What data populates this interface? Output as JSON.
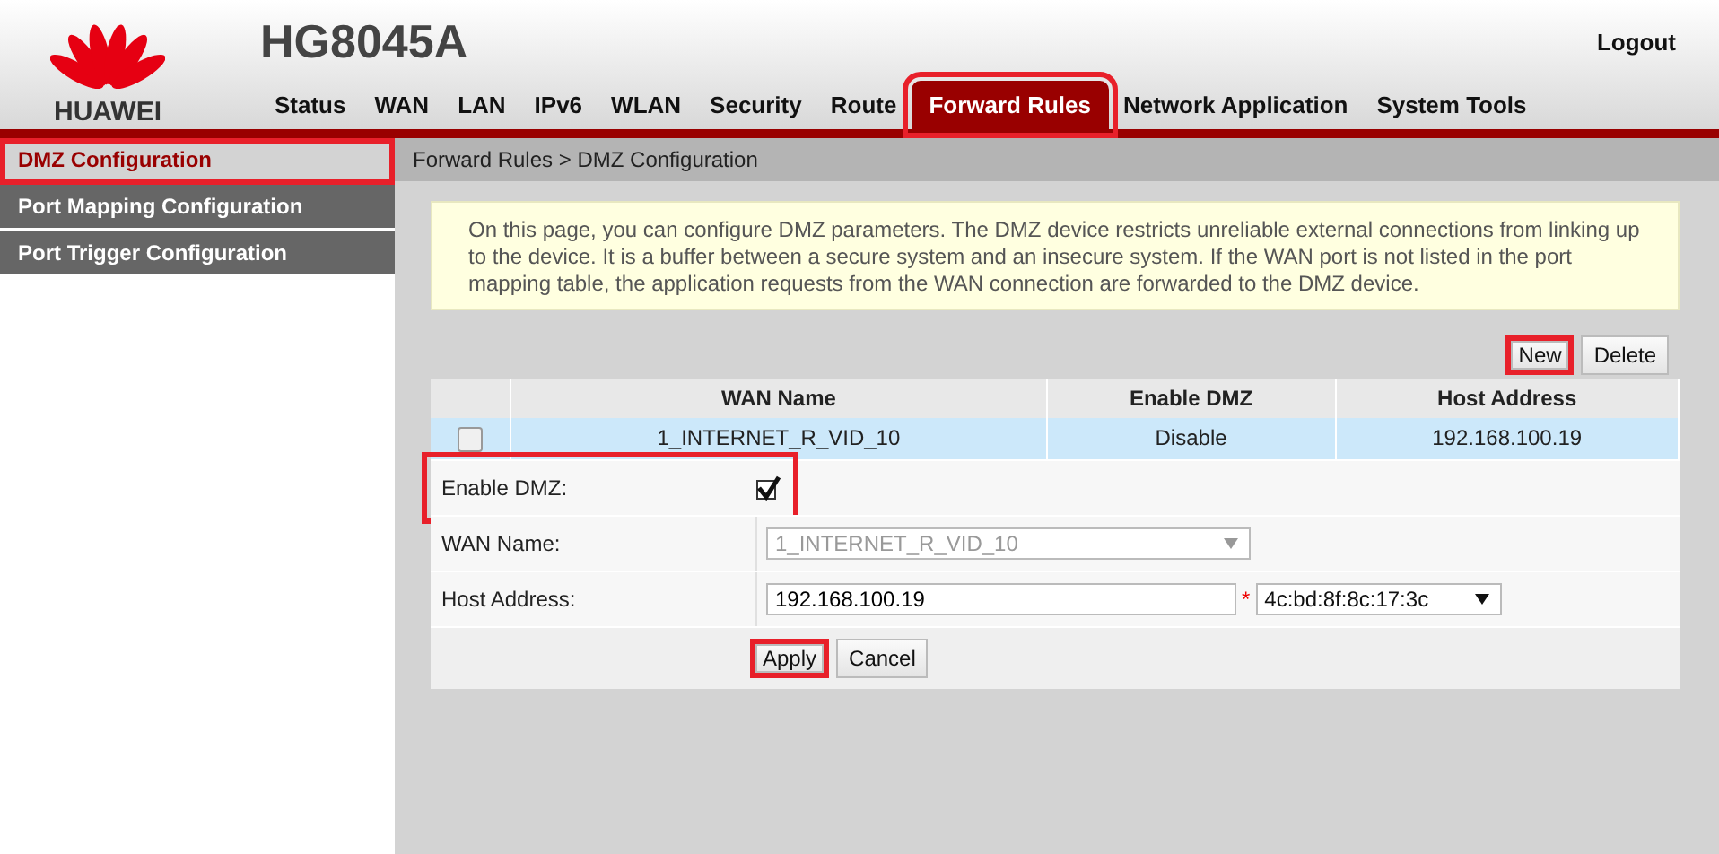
{
  "header": {
    "logo_text": "HUAWEI",
    "model": "HG8045A",
    "logout": "Logout"
  },
  "nav": [
    {
      "label": "Status",
      "selected": false,
      "highlighted": false
    },
    {
      "label": "WAN",
      "selected": false,
      "highlighted": false
    },
    {
      "label": "LAN",
      "selected": false,
      "highlighted": false
    },
    {
      "label": "IPv6",
      "selected": false,
      "highlighted": false
    },
    {
      "label": "WLAN",
      "selected": false,
      "highlighted": false
    },
    {
      "label": "Security",
      "selected": false,
      "highlighted": false
    },
    {
      "label": "Route",
      "selected": false,
      "highlighted": false
    },
    {
      "label": "Forward Rules",
      "selected": true,
      "highlighted": true
    },
    {
      "label": "Network Application",
      "selected": false,
      "highlighted": false
    },
    {
      "label": "System Tools",
      "selected": false,
      "highlighted": false
    }
  ],
  "sidebar": {
    "items": [
      {
        "label": "DMZ Configuration",
        "selected": true,
        "highlighted": true
      },
      {
        "label": "Port Mapping Configuration",
        "selected": false,
        "highlighted": false
      },
      {
        "label": "Port Trigger Configuration",
        "selected": false,
        "highlighted": false
      }
    ]
  },
  "breadcrumb": "Forward Rules > DMZ Configuration",
  "info": "On this page, you can configure DMZ parameters. The DMZ device restricts unreliable external connections from linking up to the device. It is a buffer between a secure system and an insecure system. If the WAN port is not listed in the port mapping table, the application requests from the WAN connection are forwarded to the DMZ device.",
  "table_buttons": [
    {
      "label": "New",
      "highlighted": true
    },
    {
      "label": "Delete",
      "highlighted": false
    }
  ],
  "table": {
    "columns": [
      "WAN Name",
      "Enable DMZ",
      "Host Address"
    ],
    "rows": [
      {
        "checked": false,
        "selected": true,
        "cells": [
          "1_INTERNET_R_VID_10",
          "Disable",
          "192.168.100.19"
        ]
      }
    ]
  },
  "form": {
    "enable_dmz": {
      "label": "Enable DMZ:",
      "checked": true,
      "highlighted": true
    },
    "wan_name": {
      "label": "WAN Name:",
      "value": "1_INTERNET_R_VID_10",
      "disabled": true
    },
    "host_address": {
      "label": "Host Address:",
      "value": "192.168.100.19",
      "required_mark": "*",
      "mac": "4c:bd:8f:8c:17:3c"
    }
  },
  "actions": [
    {
      "label": "Apply",
      "highlighted": true
    },
    {
      "label": "Cancel",
      "highlighted": false
    }
  ]
}
